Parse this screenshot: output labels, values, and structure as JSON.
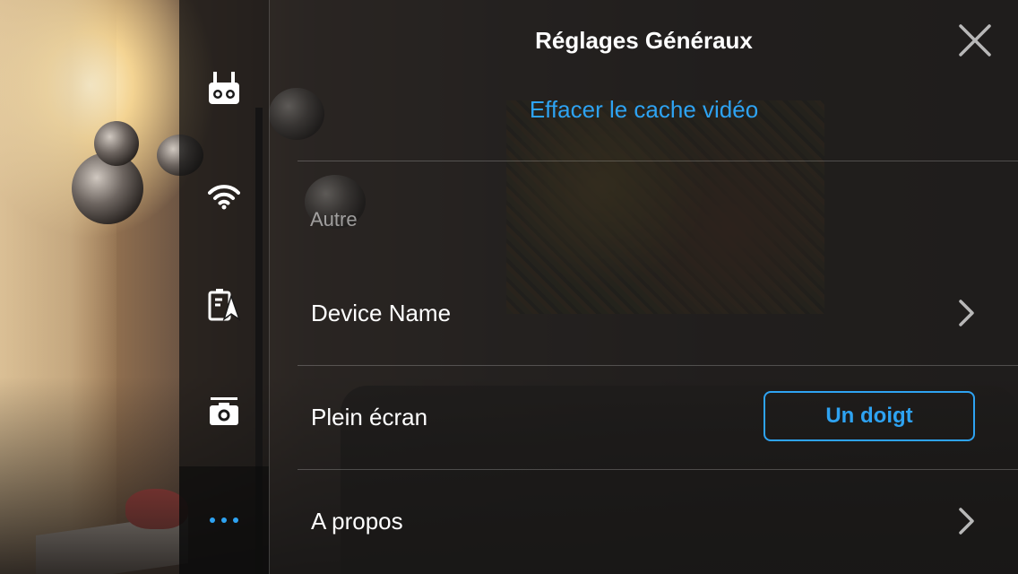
{
  "header": {
    "title": "Réglages Généraux"
  },
  "actions": {
    "clear_cache_label": "Effacer le cache vidéo"
  },
  "section": {
    "title": "Autre"
  },
  "rows": [
    {
      "label": "Device Name",
      "control": "chevron"
    },
    {
      "label": "Plein écran",
      "control": "button",
      "button_label": "Un doigt"
    },
    {
      "label": "A propos",
      "control": "chevron"
    }
  ],
  "sidebar": {
    "items": [
      {
        "icon": "remote-controller-icon",
        "active": false
      },
      {
        "icon": "wifi-icon",
        "active": false
      },
      {
        "icon": "battery-aircraft-icon",
        "active": false
      },
      {
        "icon": "camera-icon",
        "active": false
      },
      {
        "icon": "more-icon",
        "active": true
      }
    ]
  },
  "colors": {
    "accent": "#2ea3f2",
    "text": "#ffffff",
    "muted_text": "#9a9a9a"
  }
}
